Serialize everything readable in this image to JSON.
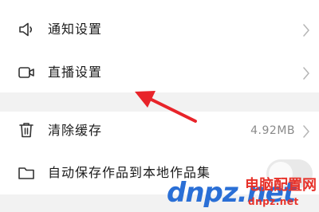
{
  "settings": {
    "items": [
      {
        "label": "通知设置",
        "icon": "speaker-icon"
      },
      {
        "label": "直播设置",
        "icon": "video-camera-icon"
      },
      {
        "label": "清除缓存",
        "icon": "trash-icon",
        "value": "4.92MB"
      },
      {
        "label": "自动保存作品到本地作品集",
        "icon": "folder-icon",
        "toggle_on": false
      }
    ]
  },
  "annotation": {
    "arrow_color": "#e8242a"
  },
  "watermark": {
    "logo_text": "dnpz.net",
    "site_name": "电脑配置网",
    "site_url": "dnpz.net"
  }
}
